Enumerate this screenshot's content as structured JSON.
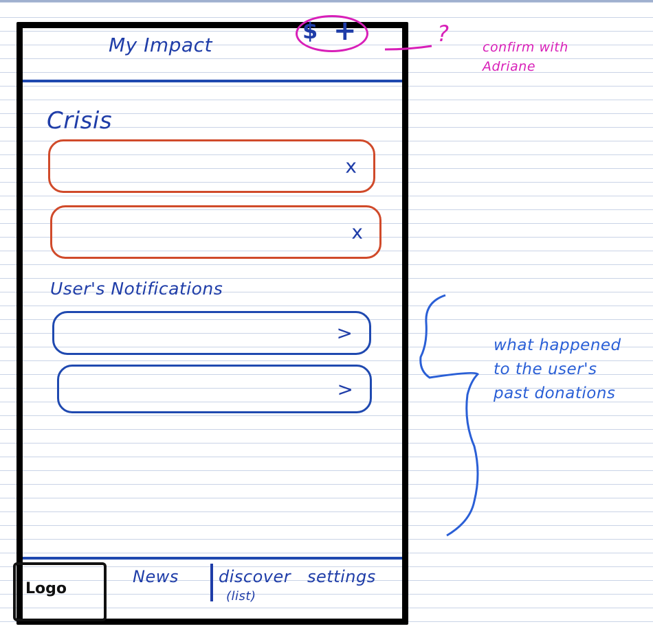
{
  "header": {
    "title": "My Impact",
    "dollar_icon": "$",
    "add_icon": "+"
  },
  "sections": {
    "crisis": {
      "heading": "Crisis",
      "cards": [
        {
          "action": "x"
        },
        {
          "action": "x"
        }
      ]
    },
    "notifications": {
      "heading": "User's Notifications",
      "cards": [
        {
          "action": ">"
        },
        {
          "action": ">"
        }
      ]
    }
  },
  "tab_bar": {
    "logo": "Logo",
    "news": "News",
    "discover": "discover",
    "discover_sub": "(list)",
    "settings": "settings"
  },
  "annotations": {
    "question_mark": "?",
    "confirm_line1": "confirm with",
    "confirm_line2": "Adriane",
    "donations": [
      "what happened",
      "to the user's",
      "past donations"
    ]
  },
  "colors": {
    "ink_blue": "#1f3da8",
    "crisis_red": "#d04a2a",
    "note_magenta": "#d81fb8",
    "note_blue": "#2a5fd6"
  }
}
